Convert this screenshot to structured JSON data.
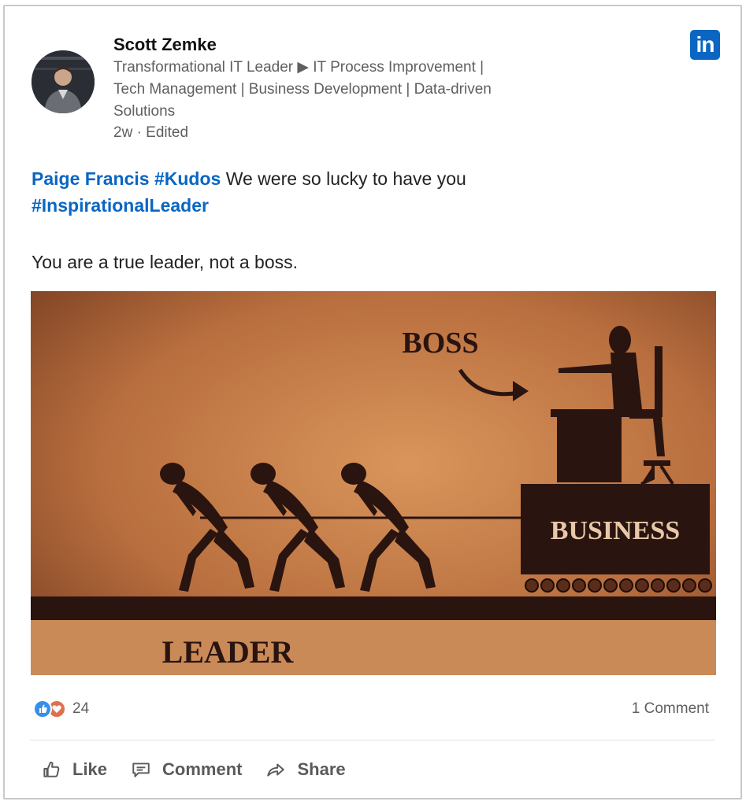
{
  "post": {
    "author": {
      "name": "Scott Zemke",
      "headline": "Transformational IT Leader ▶ IT Process Improvement | Tech Management | Business Development | Data-driven Solutions",
      "timestamp": "2w · Edited"
    },
    "brand_logo": "in",
    "text": {
      "mention": "Paige Francis",
      "hashtag1": "#Kudos",
      "line1_rest": " We were so lucky to have you",
      "hashtag2": "#InspirationalLeader",
      "line3": "You are a true leader, not a boss."
    },
    "image_labels": {
      "boss": "BOSS",
      "business": "BUSINESS",
      "leader": "LEADER"
    },
    "social": {
      "reaction_count": "24",
      "comments": "1 Comment",
      "reaction_icons": [
        "like-icon",
        "love-icon"
      ]
    },
    "actions": {
      "like": "Like",
      "comment": "Comment",
      "share": "Share"
    }
  },
  "colors": {
    "link": "#0a66c2",
    "linkedin_blue": "#0a66c2",
    "like": "#378fe9",
    "love": "#df704d",
    "image_bg": "#c07a45"
  }
}
